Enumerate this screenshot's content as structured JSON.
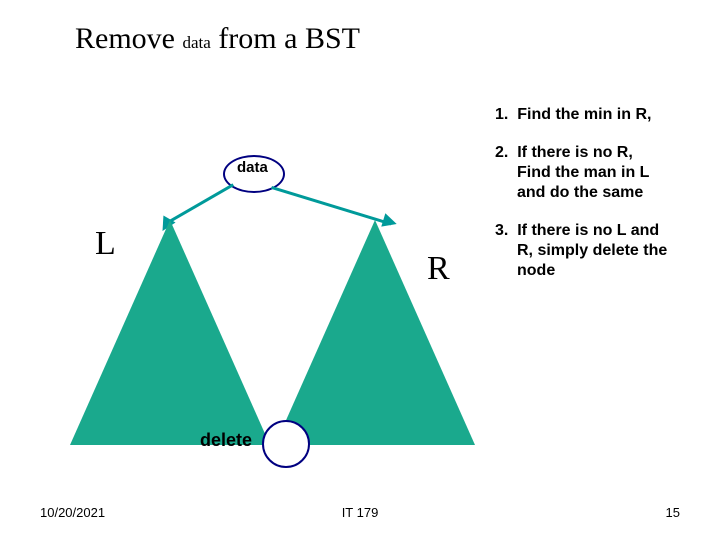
{
  "title": {
    "pre": "Remove",
    "mid": "data",
    "post": "from a BST"
  },
  "steps": {
    "s1_num": "1.",
    "s1_body": "Find the min in R,",
    "s2_num": "2.",
    "s2_l1": "If there is no R,",
    "s2_l2": "Find the man in L",
    "s2_l3": "and do the same",
    "s3_num": "3.",
    "s3_l1": "If there is no L and",
    "s3_l2": "R,  simply delete the",
    "s3_l3": "node"
  },
  "diagram": {
    "data_label": "data",
    "letter_l": "L",
    "letter_r": "R",
    "delete_label": "delete"
  },
  "footer": {
    "date": "10/20/2021",
    "course": "IT 179",
    "page": "15"
  },
  "colors": {
    "triangle_fill": "#1aa98d",
    "accent_arrow": "#009a9a",
    "circle_border": "#000080"
  }
}
